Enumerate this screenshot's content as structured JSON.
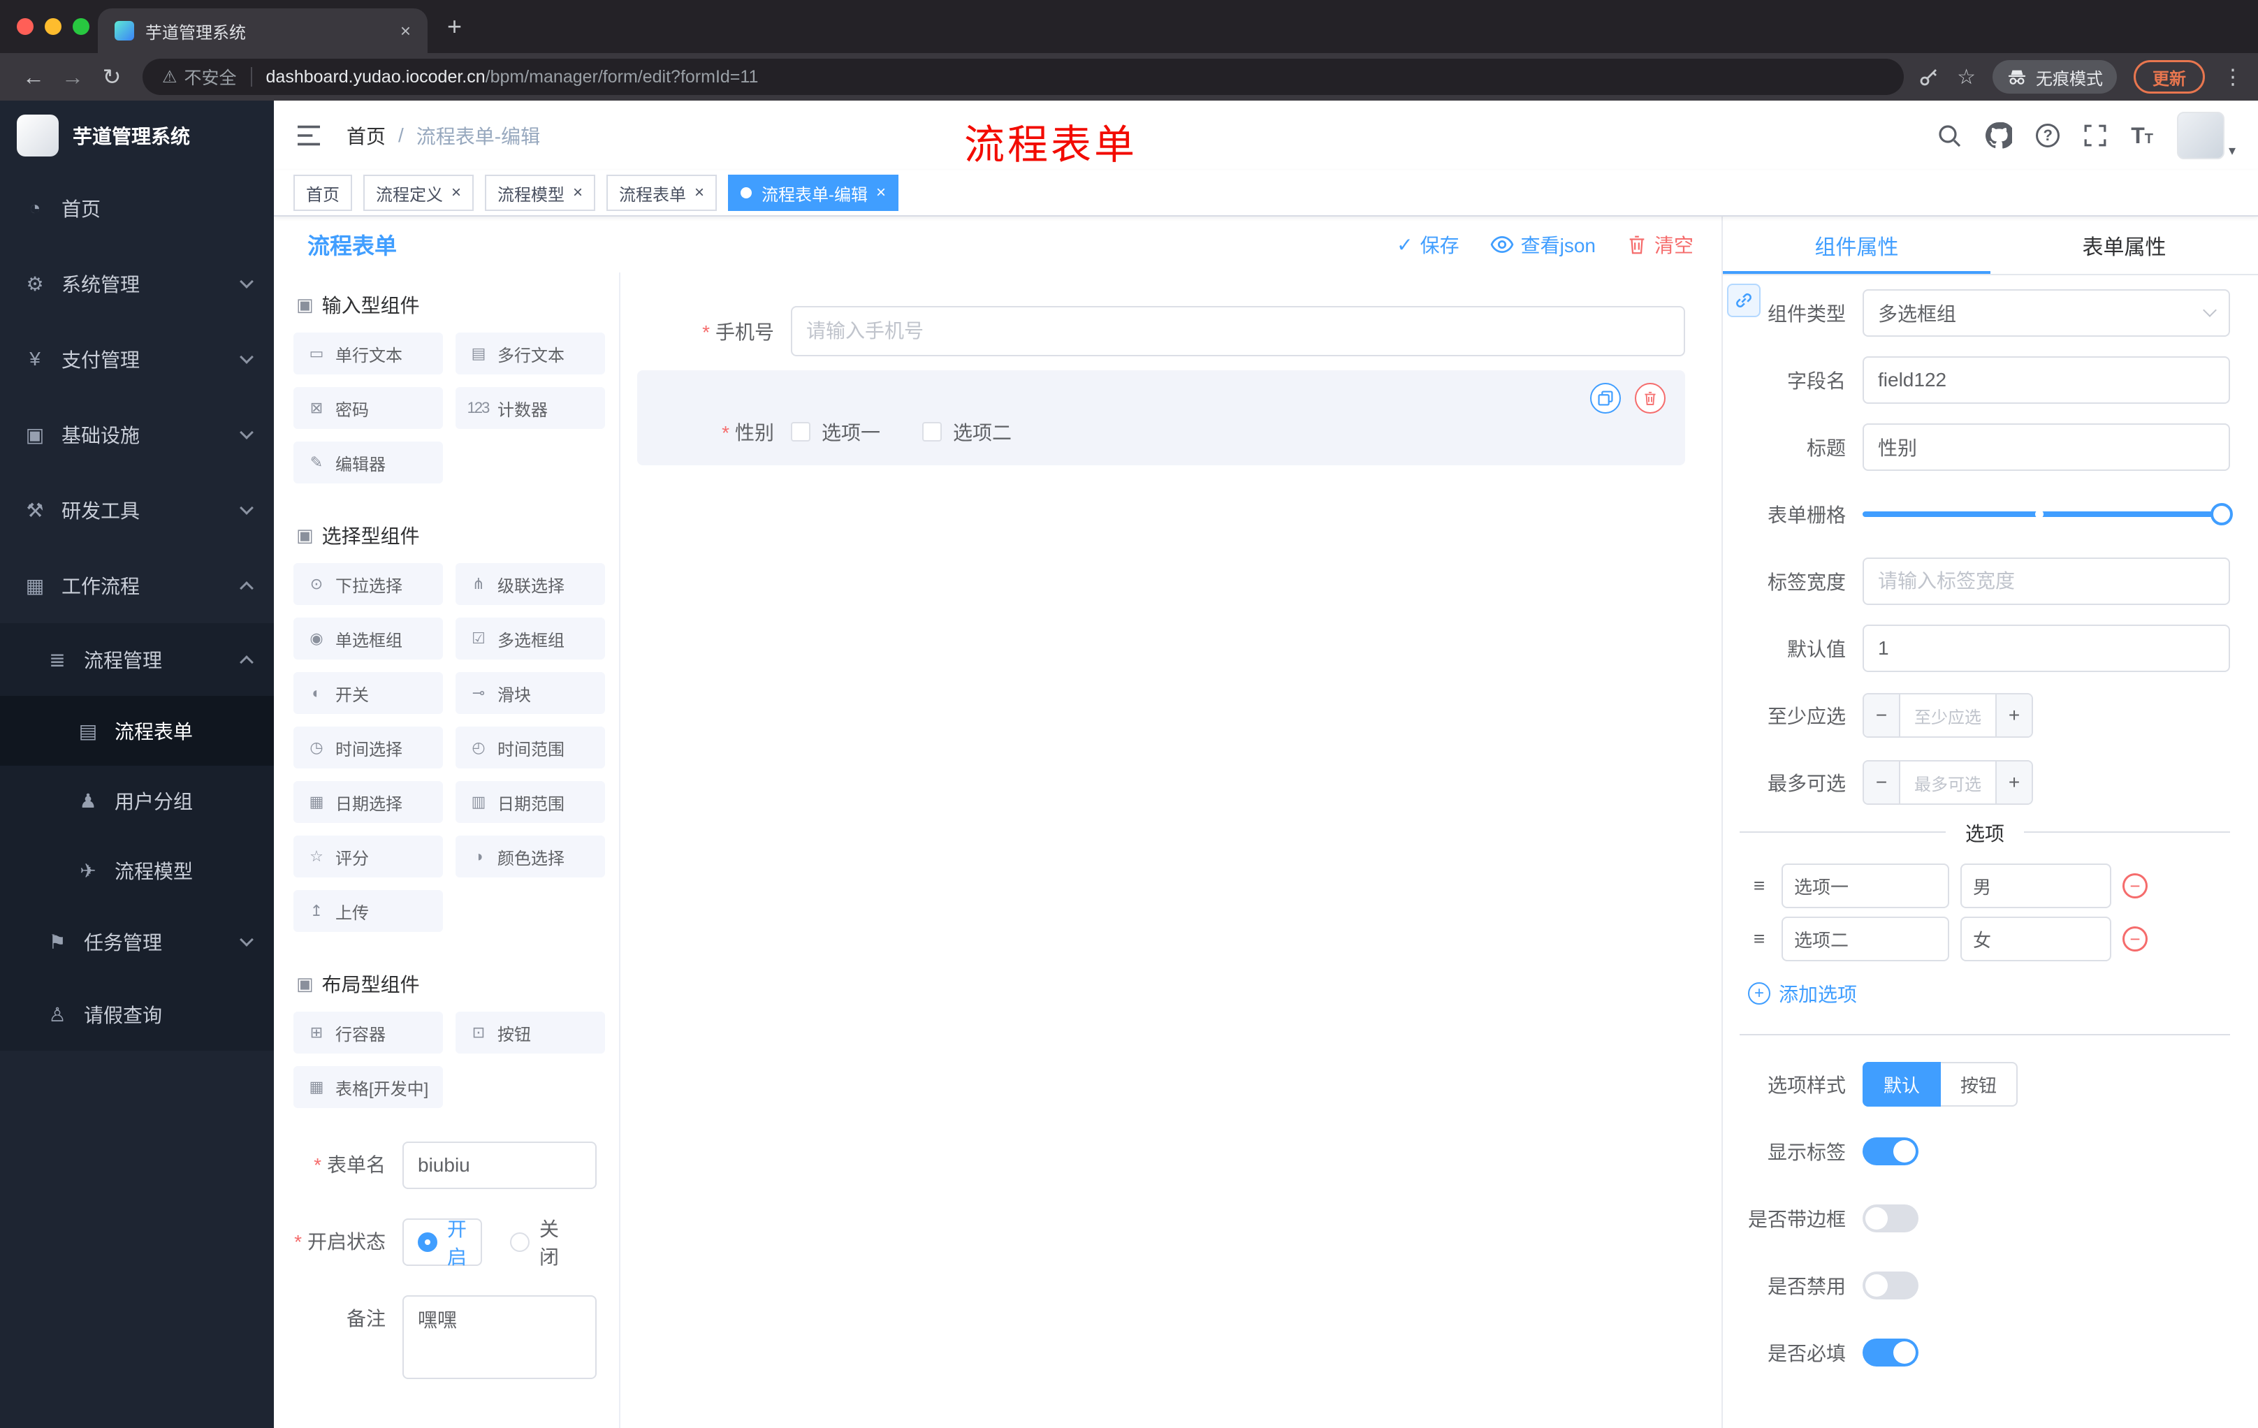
{
  "colors": {
    "primary": "#409eff",
    "danger": "#f56c6c",
    "annotation_red": "#f20b00",
    "update_orange": "#e8764f",
    "sidebar_bg": "#1e2532"
  },
  "glyphs": {
    "close": "×",
    "plus": "+",
    "minus": "−",
    "caret": "▾",
    "check": "✓",
    "back": "←",
    "forward": "→",
    "reload": "↻",
    "warning": "⚠",
    "star": "☆",
    "dots": "⋮",
    "question": "?",
    "font_big": "T",
    "font_small": "T"
  },
  "browser": {
    "tab_title": "芋道管理系统",
    "security_label": "不安全",
    "url_host": "dashboard.yudao.iocoder.cn",
    "url_path": "/bpm/manager/form/edit?formId=11",
    "incognito_label": "无痕模式",
    "update_label": "更新"
  },
  "sidebar": {
    "logo_title": "芋道管理系统",
    "items": [
      {
        "label": "首页",
        "icon": "◔"
      },
      {
        "label": "系统管理",
        "icon": "⚙"
      },
      {
        "label": "支付管理",
        "icon": "¥"
      },
      {
        "label": "基础设施",
        "icon": "▣"
      },
      {
        "label": "研发工具",
        "icon": "⚒"
      },
      {
        "label": "工作流程",
        "icon": "▦"
      },
      {
        "label": "流程管理",
        "icon": "≣"
      },
      {
        "label": "流程表单",
        "icon": "▤"
      },
      {
        "label": "用户分组",
        "icon": "♟"
      },
      {
        "label": "流程模型",
        "icon": "✈"
      },
      {
        "label": "任务管理",
        "icon": "⚑"
      },
      {
        "label": "请假查询",
        "icon": "♙"
      }
    ]
  },
  "header": {
    "breadcrumb_home": "首页",
    "breadcrumb_sep": "/",
    "breadcrumb_current": "流程表单-编辑",
    "annotation": "流程表单"
  },
  "tags": [
    {
      "label": "首页"
    },
    {
      "label": "流程定义"
    },
    {
      "label": "流程模型"
    },
    {
      "label": "流程表单"
    },
    {
      "label": "流程表单-编辑"
    }
  ],
  "designer": {
    "panel_title": "流程表单",
    "toolbar": {
      "save": "保存",
      "view_json": "查看json",
      "clear": "清空"
    },
    "groups": [
      {
        "title": "输入型组件",
        "items": [
          {
            "label": "单行文本",
            "icon": "▭"
          },
          {
            "label": "多行文本",
            "icon": "▤"
          },
          {
            "label": "密码",
            "icon": "⊠"
          },
          {
            "label": "计数器",
            "icon": "123"
          },
          {
            "label": "编辑器",
            "icon": "✎"
          }
        ]
      },
      {
        "title": "选择型组件",
        "items": [
          {
            "label": "下拉选择",
            "icon": "⊙"
          },
          {
            "label": "级联选择",
            "icon": "⋔"
          },
          {
            "label": "单选框组",
            "icon": "◉"
          },
          {
            "label": "多选框组",
            "icon": "☑"
          },
          {
            "label": "开关",
            "icon": "◐"
          },
          {
            "label": "滑块",
            "icon": "⊸"
          },
          {
            "label": "时间选择",
            "icon": "◷"
          },
          {
            "label": "时间范围",
            "icon": "◴"
          },
          {
            "label": "日期选择",
            "icon": "▦"
          },
          {
            "label": "日期范围",
            "icon": "▥"
          },
          {
            "label": "评分",
            "icon": "☆"
          },
          {
            "label": "颜色选择",
            "icon": "◑"
          },
          {
            "label": "上传",
            "icon": "↥"
          }
        ]
      },
      {
        "title": "布局型组件",
        "items": [
          {
            "label": "行容器",
            "icon": "⊞"
          },
          {
            "label": "按钮",
            "icon": "⊡"
          },
          {
            "label": "表格[开发中]",
            "icon": "▦"
          }
        ]
      }
    ],
    "meta": {
      "name_label": "表单名",
      "name_value": "biubiu",
      "status_label": "开启状态",
      "status_on": "开启",
      "status_off": "关闭",
      "remark_label": "备注",
      "remark_value": "嘿嘿"
    },
    "canvas": {
      "phone_label": "手机号",
      "phone_placeholder": "请输入手机号",
      "gender_label": "性别",
      "gender_option1": "选项一",
      "gender_option2": "选项二"
    }
  },
  "properties": {
    "tab_component": "组件属性",
    "tab_form": "表单属性",
    "rows": {
      "type_label": "组件类型",
      "type_value": "多选框组",
      "field_label": "字段名",
      "field_value": "field122",
      "title_label": "标题",
      "title_value": "性别",
      "grid_label": "表单栅格",
      "labelw_label": "标签宽度",
      "labelw_placeholder": "请输入标签宽度",
      "default_label": "默认值",
      "default_value": "1",
      "min_label": "至少应选",
      "min_placeholder": "至少应选",
      "max_label": "最多可选",
      "max_placeholder": "最多可选"
    },
    "options": {
      "divider": "选项",
      "rows": [
        {
          "label": "选项一",
          "value": "男"
        },
        {
          "label": "选项二",
          "value": "女"
        }
      ],
      "add": "添加选项"
    },
    "style": {
      "label": "选项样式",
      "opt_default": "默认",
      "opt_button": "按钮"
    },
    "switches": [
      {
        "label": "显示标签",
        "on": true
      },
      {
        "label": "是否带边框",
        "on": false
      },
      {
        "label": "是否禁用",
        "on": false
      },
      {
        "label": "是否必填",
        "on": true
      }
    ]
  }
}
